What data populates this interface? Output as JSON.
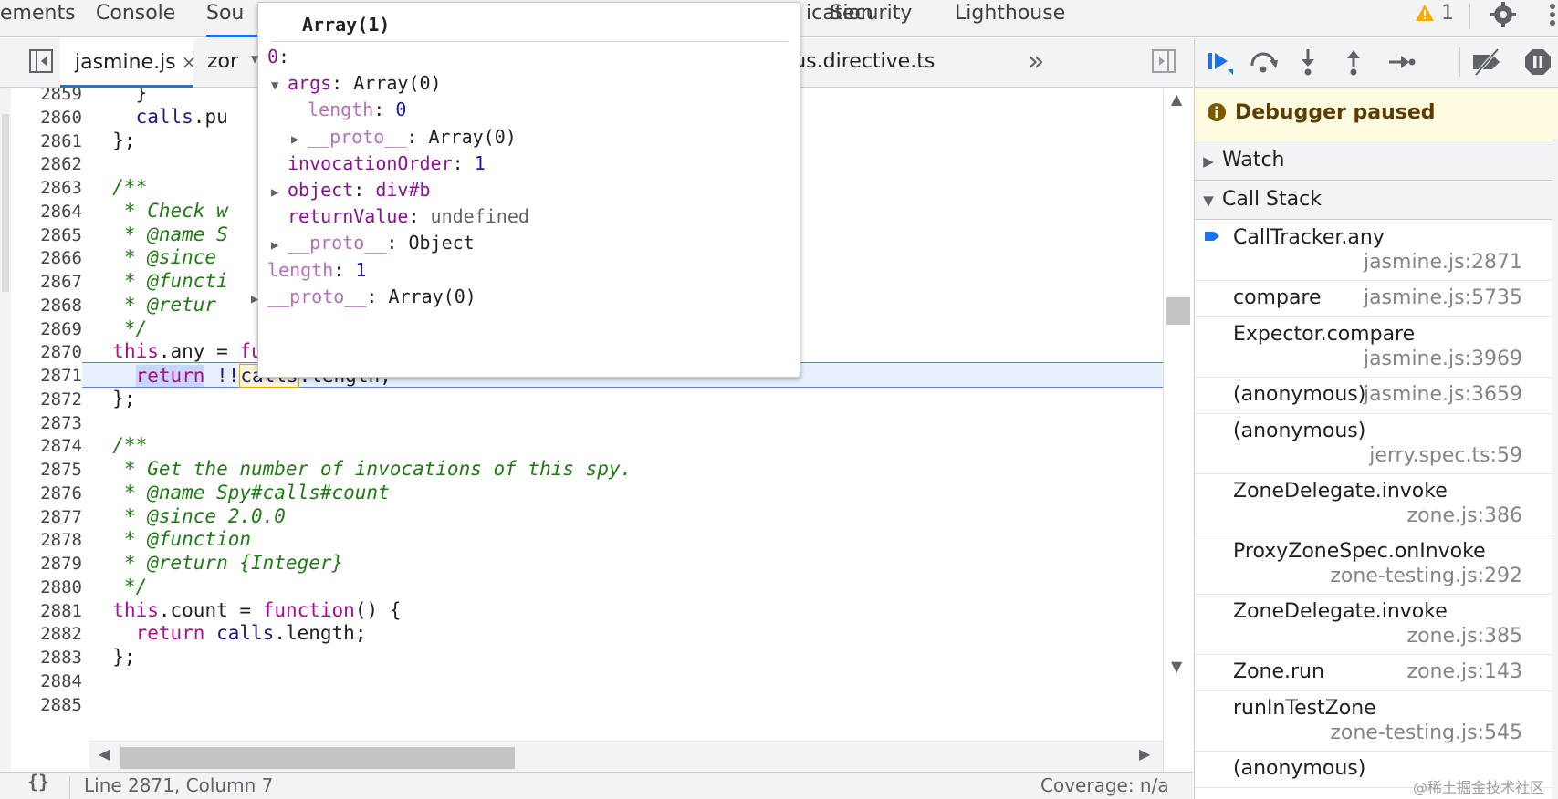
{
  "top_tabs": [
    "ements",
    "Console",
    "Sou",
    "ication",
    "Security",
    "Lighthouse"
  ],
  "warning_count": "1",
  "file_tabs": [
    {
      "label": "jasmine.js",
      "close": "×"
    },
    {
      "label": "zor"
    },
    {
      "label": "se-focus.directive.ts"
    }
  ],
  "overflow_label": "»",
  "code_lines": [
    {
      "n": "2859",
      "t": "    }"
    },
    {
      "n": "2860",
      "t": "    calls.pu"
    },
    {
      "n": "2861",
      "t": "  };"
    },
    {
      "n": "2862",
      "t": ""
    },
    {
      "n": "2863",
      "t": "  /**"
    },
    {
      "n": "2864",
      "t": "   * Check w"
    },
    {
      "n": "2865",
      "t": "   * @name S"
    },
    {
      "n": "2866",
      "t": "   * @since"
    },
    {
      "n": "2867",
      "t": "   * @functi"
    },
    {
      "n": "2868",
      "t": "   * @retur"
    },
    {
      "n": "2869",
      "t": "   */"
    },
    {
      "n": "2870",
      "t": "  this.any = function() {"
    },
    {
      "n": "2871",
      "t": "    return !!calls.length;"
    },
    {
      "n": "2872",
      "t": "  };"
    },
    {
      "n": "2873",
      "t": ""
    },
    {
      "n": "2874",
      "t": "  /**"
    },
    {
      "n": "2875",
      "t": "   * Get the number of invocations of this spy."
    },
    {
      "n": "2876",
      "t": "   * @name Spy#calls#count"
    },
    {
      "n": "2877",
      "t": "   * @since 2.0.0"
    },
    {
      "n": "2878",
      "t": "   * @function"
    },
    {
      "n": "2879",
      "t": "   * @return {Integer}"
    },
    {
      "n": "2880",
      "t": "   */"
    },
    {
      "n": "2881",
      "t": "  this.count = function() {"
    },
    {
      "n": "2882",
      "t": "    return calls.length;"
    },
    {
      "n": "2883",
      "t": "  };"
    },
    {
      "n": "2884",
      "t": ""
    },
    {
      "n": "2885",
      "t": ""
    }
  ],
  "status": {
    "format_icon": "{}",
    "position": "Line 2871, Column 7",
    "coverage": "Coverage: n/a"
  },
  "popover": {
    "header": "Array(1)",
    "rows": [
      {
        "key": "0",
        "val": ""
      },
      {
        "key": "args",
        "val": "Array(0)"
      },
      {
        "key": "length",
        "val": "0"
      },
      {
        "key": "__proto__",
        "val": "Array(0)"
      },
      {
        "key": "invocationOrder",
        "val": "1"
      },
      {
        "key": "object",
        "val": "div#b"
      },
      {
        "key": "returnValue",
        "val": "undefined"
      },
      {
        "key": "__proto__",
        "val": "Object"
      },
      {
        "key": "length",
        "val": "1"
      },
      {
        "key": "__proto__",
        "val": "Array(0)"
      }
    ]
  },
  "sidebar": {
    "paused": "Debugger paused",
    "watch": "Watch",
    "call_stack": "Call Stack",
    "frames": [
      {
        "fn": "CallTracker.any",
        "loc": "jasmine.js:2871"
      },
      {
        "fn": "compare",
        "loc": "jasmine.js:5735"
      },
      {
        "fn": "Expector.compare",
        "loc": "jasmine.js:3969"
      },
      {
        "fn": "(anonymous)",
        "loc": "jasmine.js:3659"
      },
      {
        "fn": "(anonymous)",
        "loc": "jerry.spec.ts:59"
      },
      {
        "fn": "ZoneDelegate.invoke",
        "loc": "zone.js:386"
      },
      {
        "fn": "ProxyZoneSpec.onInvoke",
        "loc": "zone-testing.js:292"
      },
      {
        "fn": "ZoneDelegate.invoke",
        "loc": "zone.js:385"
      },
      {
        "fn": "Zone.run",
        "loc": "zone.js:143"
      },
      {
        "fn": "runInTestZone",
        "loc": "zone-testing.js:545"
      },
      {
        "fn": "(anonymous)",
        "loc": ""
      }
    ]
  },
  "watermark": "@稀土掘金技术社区",
  "colors": {
    "accent": "#1a73e8",
    "paused_bg": "#fffbe0",
    "exec_line": "#e8f0fe"
  }
}
